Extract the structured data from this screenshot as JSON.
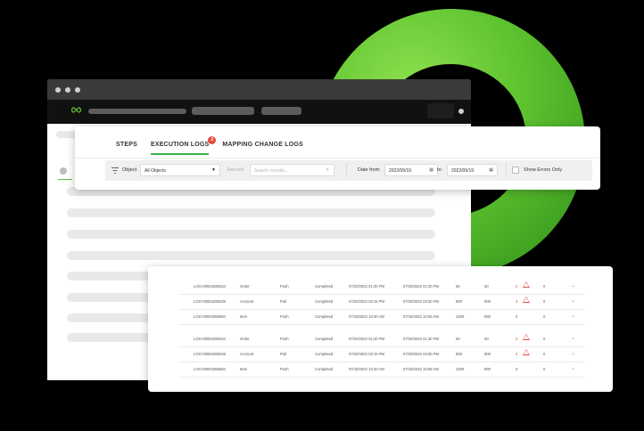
{
  "tabs": [
    {
      "label": "STEPS"
    },
    {
      "label": "EXECUTION LOGS",
      "badge": "2"
    },
    {
      "label": "MAPPING CHANGE LOGS"
    }
  ],
  "filters": {
    "object_label": "Object:",
    "object_value": "All Objects",
    "record_label": "Record:",
    "search_placeholder": "Search records...",
    "date_from_label": "Date from:",
    "date_from": "2022/09/19",
    "date_to_label": "to:",
    "date_to": "2022/09/19",
    "show_errors_label": "Show Errors Only"
  },
  "logs": [
    {
      "id": "LOG-00004289234",
      "object": "Order",
      "direction": "Push",
      "status": "Completed",
      "started": "07/20/2022 01:20 PM",
      "finished": "07/20/2022 01:30 PM",
      "processed": "50",
      "succeeded": "50",
      "errors": "2",
      "warnings": "0"
    },
    {
      "id": "LOG-00004289239",
      "object": "Account",
      "direction": "Pull",
      "status": "Completed",
      "started": "07/20/2022 03:15 PM",
      "finished": "07/20/2022 03:30 PM",
      "processed": "800",
      "succeeded": "800",
      "errors": "4",
      "warnings": "0"
    },
    {
      "id": "LOG-00004355584",
      "object": "Item",
      "direction": "Push",
      "status": "Completed",
      "started": "07/19/2022 10:30 AM",
      "finished": "07/19/2022 10:55 AM",
      "processed": "1000",
      "succeeded": "990",
      "errors": "0",
      "warnings": "0"
    },
    {
      "id": "LOG-00004289234",
      "object": "Order",
      "direction": "Push",
      "status": "Completed",
      "started": "07/20/2022 01:20 PM",
      "finished": "07/20/2022 01:30 PM",
      "processed": "50",
      "succeeded": "50",
      "errors": "2",
      "warnings": "0"
    },
    {
      "id": "LOG-00004289239",
      "object": "Account",
      "direction": "Pull",
      "status": "Completed",
      "started": "07/20/2022 03:15 PM",
      "finished": "07/20/2022 03:30 PM",
      "processed": "800",
      "succeeded": "800",
      "errors": "4",
      "warnings": "0"
    },
    {
      "id": "LOG-00004355584",
      "object": "Item",
      "direction": "Push",
      "status": "Completed",
      "started": "07/19/2022 10:30 AM",
      "finished": "07/19/2022 10:55 AM",
      "processed": "1000",
      "succeeded": "990",
      "errors": "0",
      "warnings": "0"
    }
  ],
  "colors": {
    "accent": "#3bb54a",
    "error": "#e64b3c",
    "ring": "#5cc22e"
  },
  "icons": [
    "filter-icon",
    "chevron-down-icon",
    "search-icon",
    "calendar-icon",
    "warning-icon"
  ]
}
